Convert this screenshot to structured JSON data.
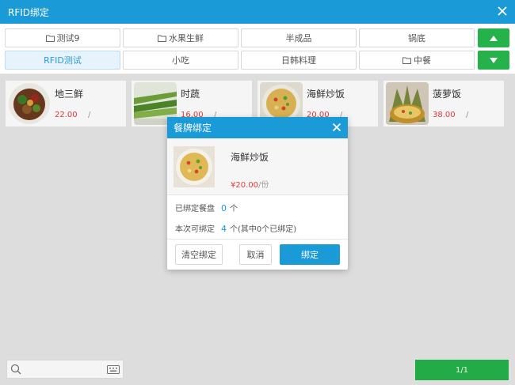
{
  "window": {
    "title": "RFID绑定"
  },
  "categories": [
    {
      "label": "测试9",
      "folder": true,
      "active": false
    },
    {
      "label": "水果生鲜",
      "folder": true,
      "active": false
    },
    {
      "label": "半成品",
      "folder": false,
      "active": false
    },
    {
      "label": "锅底",
      "folder": false,
      "active": false
    },
    {
      "label": "RFID测试",
      "folder": false,
      "active": true
    },
    {
      "label": "小吃",
      "folder": false,
      "active": false
    },
    {
      "label": "日韩料理",
      "folder": false,
      "active": false
    },
    {
      "label": "中餐",
      "folder": true,
      "active": false
    }
  ],
  "dishes": [
    {
      "name": "地三鲜",
      "price": "22.00",
      "slash": "/"
    },
    {
      "name": "时蔬",
      "price": "16.00",
      "slash": "/"
    },
    {
      "name": "海鲜炒饭",
      "price": "20.00",
      "slash": "/"
    },
    {
      "name": "菠萝饭",
      "price": "38.00",
      "slash": "/"
    }
  ],
  "pager": {
    "text": "1/1"
  },
  "dialog": {
    "title": "餐牌绑定",
    "dish_name": "海鲜炒饭",
    "price": "¥20.00",
    "sep": "/",
    "unit": "份",
    "bound_label": "已绑定餐盘",
    "bound_count": "0",
    "bound_unit": "个",
    "avail_label": "本次可绑定",
    "avail_count": "4",
    "avail_unit": "个(其中0个已绑定)",
    "clear_label": "清空绑定",
    "cancel_label": "取消",
    "bind_label": "绑定"
  },
  "colors": {
    "header": "#1a9ad6",
    "green": "#25b24a",
    "price": "#e23d3d"
  }
}
